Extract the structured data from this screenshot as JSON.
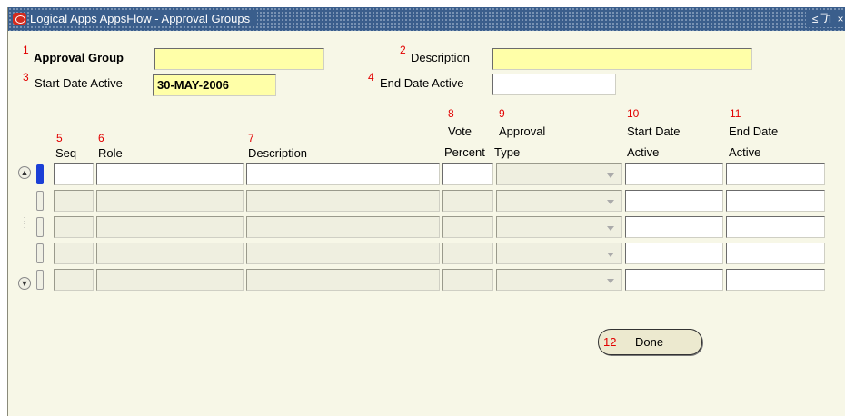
{
  "window": {
    "title": "Logical Apps AppsFlow - Approval Groups",
    "controls": [
      "≤",
      "̅Л",
      "×"
    ]
  },
  "header": {
    "approval_group": {
      "num": "1",
      "label": "Approval Group",
      "value": ""
    },
    "description": {
      "num": "2",
      "label": "Description",
      "value": ""
    },
    "start_date_active": {
      "num": "3",
      "label": "Start Date Active",
      "value": "30-MAY-2006"
    },
    "end_date_active": {
      "num": "4",
      "label": "End Date Active",
      "value": ""
    }
  },
  "table": {
    "columns": [
      {
        "num": "5",
        "label": "Seq"
      },
      {
        "num": "6",
        "label": "Role"
      },
      {
        "num": "7",
        "label": "Description"
      },
      {
        "num": "8",
        "label_line1": "Vote",
        "label_line2": "Percent"
      },
      {
        "num": "9",
        "label_line1": "Approval",
        "label_line2": "Type"
      },
      {
        "num": "10",
        "label_line1": "Start Date",
        "label_line2": "Active"
      },
      {
        "num": "11",
        "label_line1": "End Date",
        "label_line2": "Active"
      }
    ],
    "rows": [
      {
        "seq": "",
        "role": "",
        "description": "",
        "vote_percent": "",
        "approval_type": "",
        "start_date": "",
        "end_date": ""
      },
      {
        "seq": "",
        "role": "",
        "description": "",
        "vote_percent": "",
        "approval_type": "",
        "start_date": "",
        "end_date": ""
      },
      {
        "seq": "",
        "role": "",
        "description": "",
        "vote_percent": "",
        "approval_type": "",
        "start_date": "",
        "end_date": ""
      },
      {
        "seq": "",
        "role": "",
        "description": "",
        "vote_percent": "",
        "approval_type": "",
        "start_date": "",
        "end_date": ""
      },
      {
        "seq": "",
        "role": "",
        "description": "",
        "vote_percent": "",
        "approval_type": "",
        "start_date": "",
        "end_date": ""
      }
    ]
  },
  "done_button": {
    "num": "12",
    "label": "Done"
  }
}
